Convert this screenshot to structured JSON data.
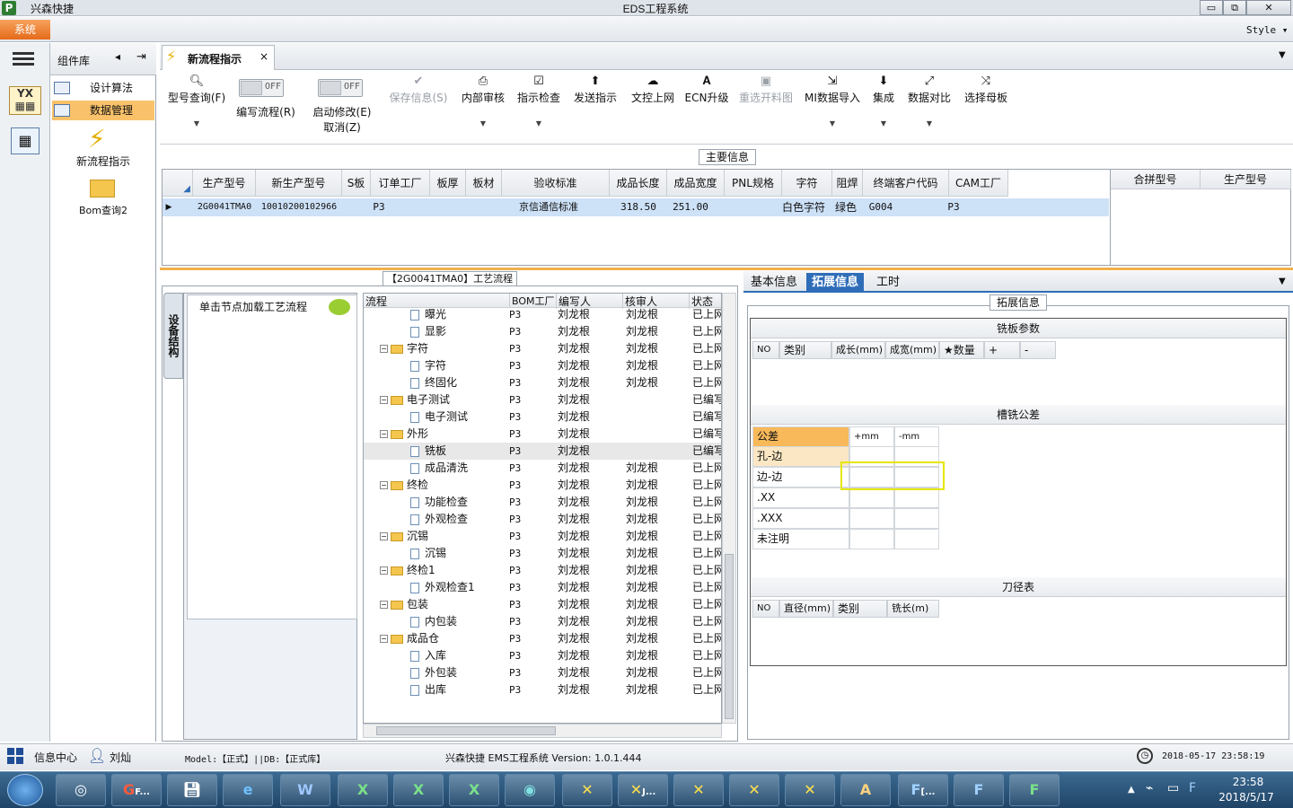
{
  "window": {
    "app_name": "兴森快捷",
    "title": "EDS工程系统",
    "min": "▭",
    "max": "⧉",
    "close": "✕"
  },
  "menu": {
    "system": "系统",
    "style": "Style"
  },
  "component_lib": {
    "title": "组件库",
    "items": [
      {
        "label": "设计算法"
      },
      {
        "label": "数据管理"
      }
    ],
    "tiles": [
      {
        "label": "新流程指示"
      },
      {
        "label": "Bom查询2"
      }
    ]
  },
  "doc_tab": {
    "title": "新流程指示",
    "close": "×"
  },
  "toolbar": {
    "model_query": "型号查询(F)",
    "edit_flow": "编写流程(R)",
    "start_modify": "启动修改(E)",
    "cancel": "取消(Z)",
    "off": "OFF",
    "save_info": "保存信息(S)",
    "internal_review": "内部审核",
    "instr_check": "指示检查",
    "send_instr": "发送指示",
    "doc_upload": "文控上网",
    "ecn_upgrade": "ECN升级",
    "reselect": "重选开料图",
    "mi_import": "MI数据导入",
    "integrate": "集成",
    "data_compare": "数据对比",
    "select_master": "选择母板"
  },
  "main_info": {
    "title": "主要信息",
    "columns": [
      "生产型号",
      "新生产型号",
      "S板",
      "订单工厂",
      "板厚",
      "板材",
      "验收标准",
      "成品长度",
      "成品宽度",
      "PNL规格",
      "字符",
      "阻焊",
      "终端客户代码",
      "CAM工厂"
    ],
    "row": [
      "2G0041TMA0",
      "10010200102966",
      "",
      "P3",
      "",
      "",
      "京信通信标准",
      "318.50",
      "251.00",
      "",
      "白色字符",
      "绿色",
      "G004",
      "P3"
    ],
    "right_columns": [
      "合拼型号",
      "生产型号"
    ]
  },
  "flow": {
    "title": "【2G0041TMA0】工艺流程",
    "equip_tab": "设备结构",
    "node_hint": "单击节点加载工艺流程",
    "columns": [
      "流程",
      "BOM工厂",
      "编写人",
      "核审人",
      "状态"
    ],
    "rows": [
      {
        "name": "曝光",
        "level": 2,
        "type": "doc",
        "bom": "P3",
        "writer": "刘龙根",
        "reviewer": "刘龙根",
        "status": "已上网"
      },
      {
        "name": "显影",
        "level": 2,
        "type": "doc",
        "bom": "P3",
        "writer": "刘龙根",
        "reviewer": "刘龙根",
        "status": "已上网"
      },
      {
        "name": "字符",
        "level": 1,
        "type": "folder",
        "bom": "P3",
        "writer": "刘龙根",
        "reviewer": "刘龙根",
        "status": "已上网"
      },
      {
        "name": "字符",
        "level": 2,
        "type": "doc",
        "bom": "P3",
        "writer": "刘龙根",
        "reviewer": "刘龙根",
        "status": "已上网"
      },
      {
        "name": "终固化",
        "level": 2,
        "type": "doc",
        "bom": "P3",
        "writer": "刘龙根",
        "reviewer": "刘龙根",
        "status": "已上网"
      },
      {
        "name": "电子测试",
        "level": 1,
        "type": "folder",
        "bom": "P3",
        "writer": "刘龙根",
        "reviewer": "",
        "status": "已编写"
      },
      {
        "name": "电子测试",
        "level": 2,
        "type": "doc",
        "bom": "P3",
        "writer": "刘龙根",
        "reviewer": "",
        "status": "已编写"
      },
      {
        "name": "外形",
        "level": 1,
        "type": "folder",
        "bom": "P3",
        "writer": "刘龙根",
        "reviewer": "",
        "status": "已编写"
      },
      {
        "name": "铣板",
        "level": 2,
        "type": "doc",
        "bom": "P3",
        "writer": "刘龙根",
        "reviewer": "",
        "status": "已编写",
        "selected": true
      },
      {
        "name": "成品清洗",
        "level": 2,
        "type": "doc",
        "bom": "P3",
        "writer": "刘龙根",
        "reviewer": "刘龙根",
        "status": "已上网"
      },
      {
        "name": "终检",
        "level": 1,
        "type": "folder",
        "bom": "P3",
        "writer": "刘龙根",
        "reviewer": "刘龙根",
        "status": "已上网"
      },
      {
        "name": "功能检查",
        "level": 2,
        "type": "doc",
        "bom": "P3",
        "writer": "刘龙根",
        "reviewer": "刘龙根",
        "status": "已上网"
      },
      {
        "name": "外观检查",
        "level": 2,
        "type": "doc",
        "bom": "P3",
        "writer": "刘龙根",
        "reviewer": "刘龙根",
        "status": "已上网"
      },
      {
        "name": "沉锡",
        "level": 1,
        "type": "folder",
        "bom": "P3",
        "writer": "刘龙根",
        "reviewer": "刘龙根",
        "status": "已上网"
      },
      {
        "name": "沉锡",
        "level": 2,
        "type": "doc",
        "bom": "P3",
        "writer": "刘龙根",
        "reviewer": "刘龙根",
        "status": "已上网"
      },
      {
        "name": "终检1",
        "level": 1,
        "type": "folder",
        "bom": "P3",
        "writer": "刘龙根",
        "reviewer": "刘龙根",
        "status": "已上网"
      },
      {
        "name": "外观检查1",
        "level": 2,
        "type": "doc",
        "bom": "P3",
        "writer": "刘龙根",
        "reviewer": "刘龙根",
        "status": "已上网"
      },
      {
        "name": "包装",
        "level": 1,
        "type": "folder",
        "bom": "P3",
        "writer": "刘龙根",
        "reviewer": "刘龙根",
        "status": "已上网"
      },
      {
        "name": "内包装",
        "level": 2,
        "type": "doc",
        "bom": "P3",
        "writer": "刘龙根",
        "reviewer": "刘龙根",
        "status": "已上网"
      },
      {
        "name": "成品仓",
        "level": 1,
        "type": "folder",
        "bom": "P3",
        "writer": "刘龙根",
        "reviewer": "刘龙根",
        "status": "已上网"
      },
      {
        "name": "入库",
        "level": 2,
        "type": "doc",
        "bom": "P3",
        "writer": "刘龙根",
        "reviewer": "刘龙根",
        "status": "已上网"
      },
      {
        "name": "外包装",
        "level": 2,
        "type": "doc",
        "bom": "P3",
        "writer": "刘龙根",
        "reviewer": "刘龙根",
        "status": "已上网"
      },
      {
        "name": "出库",
        "level": 2,
        "type": "doc",
        "bom": "P3",
        "writer": "刘龙根",
        "reviewer": "刘龙根",
        "status": "已上网"
      }
    ]
  },
  "right": {
    "tabs": [
      "基本信息",
      "拓展信息",
      "工时"
    ],
    "ext_title": "拓展信息",
    "milling": {
      "title": "铣板参数",
      "columns": [
        "NO",
        "类别",
        "成长(mm)",
        "成宽(mm)",
        "★数量",
        "+",
        "-"
      ]
    },
    "tolerance": {
      "title": "槽铣公差",
      "header": [
        "公差",
        "+mm",
        "-mm"
      ],
      "rows": [
        "孔-边",
        "边-边",
        ".XX",
        ".XXX",
        "未注明"
      ]
    },
    "tools": {
      "title": "刀径表",
      "columns": [
        "NO",
        "直径(mm)",
        "类别",
        "铣长(m)"
      ]
    }
  },
  "status": {
    "info_center": "信息中心",
    "user": "刘灿",
    "model": "Model:【正式】||DB:【正式库】",
    "version": "兴森快捷 EMS工程系统 Version: 1.0.1.444",
    "datetime": "2018-05-17 23:58:19"
  },
  "taskbar": {
    "time": "23:58",
    "date": "2018/5/17",
    "f_label": "F...",
    "j_label": "J...",
    "bracket_label": "[..."
  }
}
